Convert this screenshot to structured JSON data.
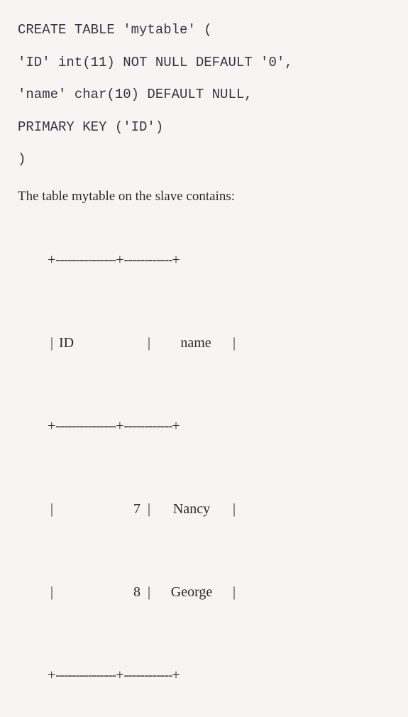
{
  "sql": {
    "line1": "CREATE TABLE 'mytable' (",
    "line2": "'ID' int(11) NOT NULL DEFAULT '0',",
    "line3": "'name' char(10) DEFAULT NULL,",
    "line4": "PRIMARY KEY ('ID')",
    "line5": ")"
  },
  "description": "The table mytable on the slave contains:",
  "table": {
    "border1": "+---------------+------------+",
    "header_id": "ID",
    "header_name": "name",
    "border2": "+---------------+------------+",
    "rows": [
      {
        "id": "7",
        "name": "Nancy"
      },
      {
        "id": "8",
        "name": "George"
      }
    ],
    "border3": "+---------------+------------+"
  }
}
